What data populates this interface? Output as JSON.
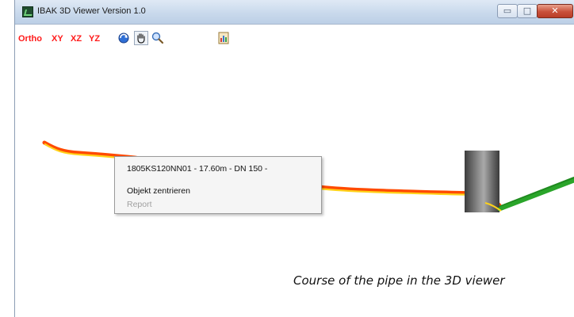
{
  "window": {
    "title": "IBAK 3D Viewer Version 1.0",
    "controls": {
      "minimize": "▭",
      "maximize": "□",
      "close": "✕"
    }
  },
  "toolbar": {
    "view_buttons": [
      "Ortho",
      "XY",
      "XZ",
      "YZ"
    ],
    "tools": [
      "rotate-icon",
      "pan-hand-icon",
      "zoom-magnifier-icon",
      "report-icon"
    ]
  },
  "context_menu": {
    "header": "1805KS120NN01 -  17.60m - DN 150 -",
    "items": [
      {
        "label": "Objekt zentrieren",
        "enabled": true
      },
      {
        "label": "Report",
        "enabled": false
      }
    ]
  },
  "caption": "Course of the pipe in the 3D viewer",
  "colors": {
    "view_button": "#ff1a1a",
    "pipe_outer": "#ff4a00",
    "pipe_inner": "#ffd21a",
    "pipe_connected": "#1f8a1f"
  }
}
